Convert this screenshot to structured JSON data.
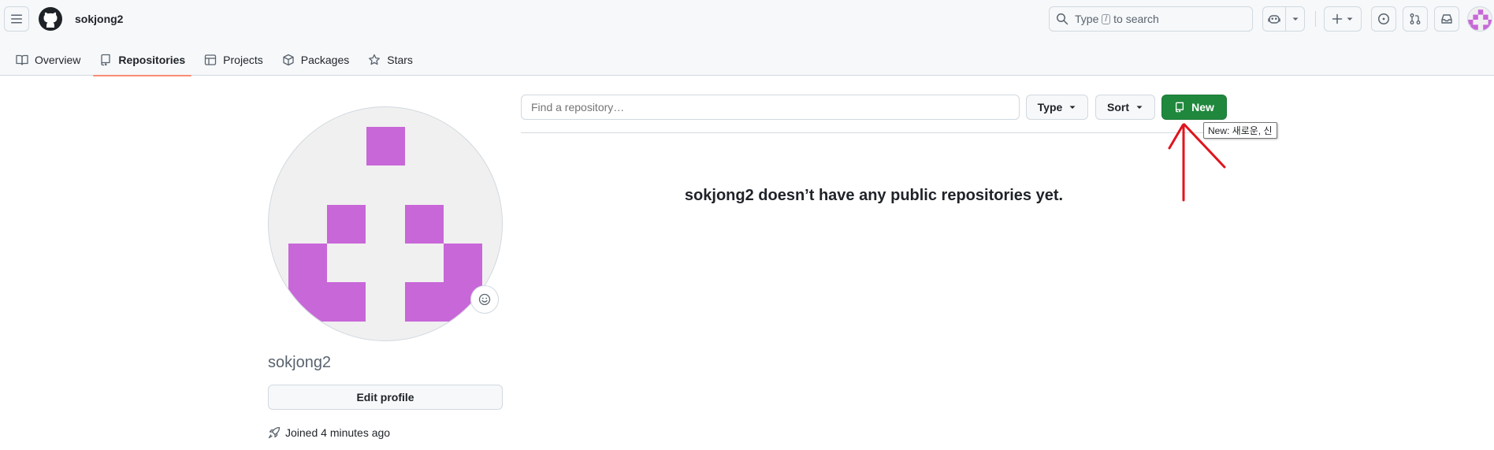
{
  "header": {
    "username": "sokjong2",
    "search": {
      "text_before": "Type",
      "key": "/",
      "text_after": "to search"
    }
  },
  "icons": {
    "menu": "hamburger-menu-icon",
    "logo": "github-logo-icon",
    "search": "search-icon",
    "copilot": "copilot-icon",
    "plus": "plus-icon",
    "issues": "issue-opened-icon",
    "pull_requests": "git-pull-request-icon",
    "inbox": "inbox-icon",
    "rocket": "rocket-icon",
    "smiley": "smiley-icon",
    "repo": "repo-icon"
  },
  "tabs": [
    {
      "label": "Overview",
      "icon": "book-icon"
    },
    {
      "label": "Repositories",
      "icon": "repo-icon",
      "selected": true
    },
    {
      "label": "Projects",
      "icon": "table-icon"
    },
    {
      "label": "Packages",
      "icon": "package-icon"
    },
    {
      "label": "Stars",
      "icon": "star-icon"
    }
  ],
  "profile": {
    "name": "sokjong2",
    "edit_label": "Edit profile",
    "joined": "Joined 4 minutes ago"
  },
  "repos": {
    "search_placeholder": "Find a repository…",
    "type_label": "Type",
    "sort_label": "Sort",
    "new_label": "New",
    "tooltip": "New: 새로운, 신",
    "empty_message": "sokjong2 doesn’t have any public repositories yet."
  },
  "colors": {
    "accent_green": "#1f883d",
    "avatar_purple": "#c867d8",
    "tab_underline": "#fd8c73",
    "annotation_red": "#e0141e"
  }
}
